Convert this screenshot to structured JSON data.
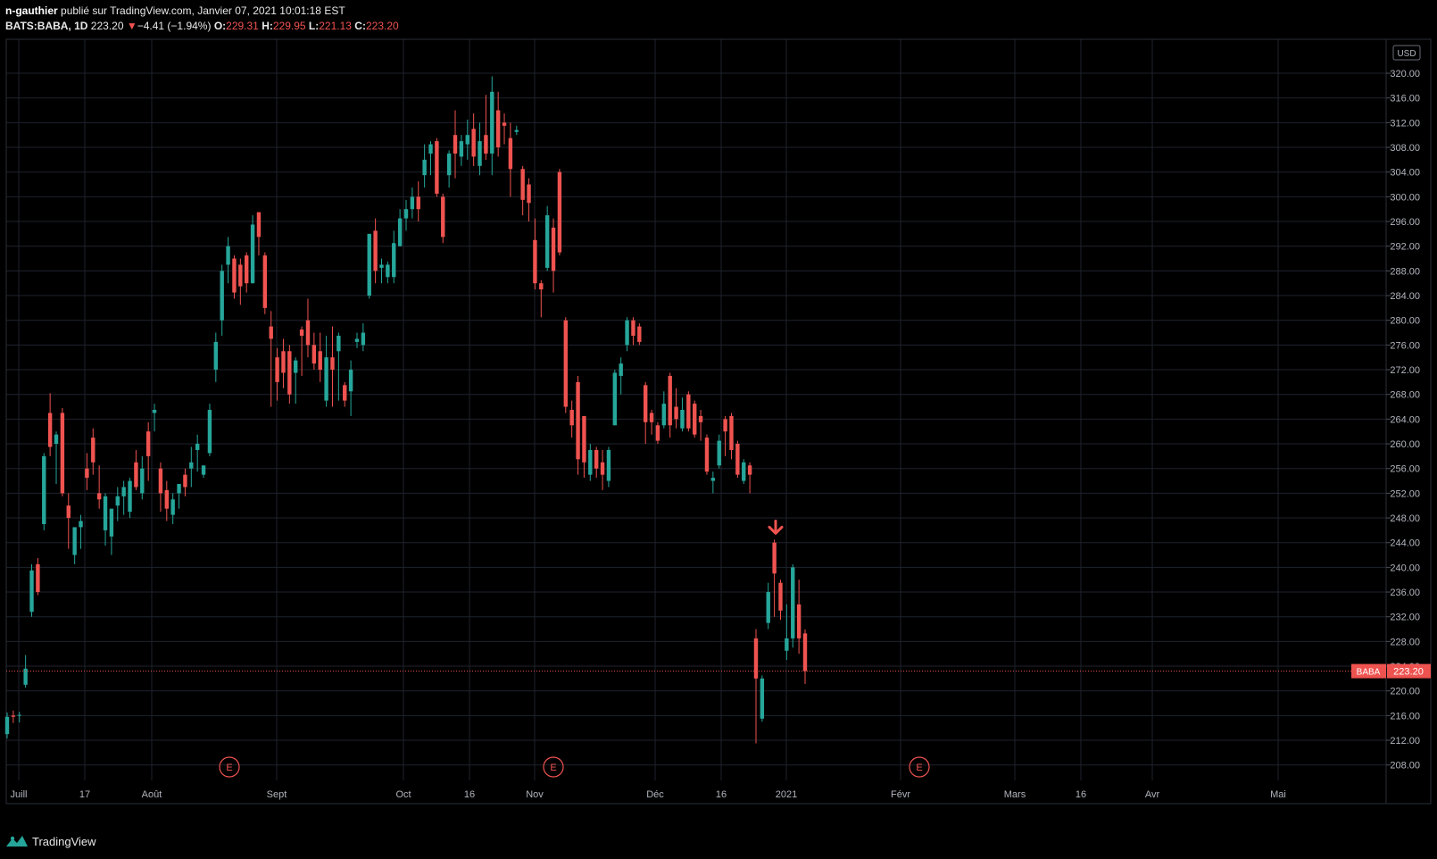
{
  "header": {
    "author": "n-gauthier",
    "published_text": "publié sur TradingView.com, Janvier 07, 2021 10:01:18 EST",
    "symbol": "BATS:BABA, 1D",
    "last_price": "223.20",
    "change": "−4.41 (−1.94%)",
    "open_label": "O:",
    "open": "229.31",
    "high_label": "H:",
    "high": "229.95",
    "low_label": "L:",
    "low": "221.13",
    "close_label": "C:",
    "close": "223.20"
  },
  "currency_badge": "USD",
  "price_tag": {
    "symbol": "BABA",
    "value": "223.20"
  },
  "footer": {
    "brand": "TradingView"
  },
  "colors": {
    "up": "#26a69a",
    "down": "#ef5350",
    "grid": "#1e222d",
    "background": "#000000"
  },
  "chart_data": {
    "type": "candlestick",
    "y_axis_ticks": [
      "320.00",
      "316.00",
      "312.00",
      "308.00",
      "304.00",
      "300.00",
      "296.00",
      "292.00",
      "288.00",
      "284.00",
      "280.00",
      "276.00",
      "272.00",
      "268.00",
      "264.00",
      "260.00",
      "256.00",
      "252.00",
      "248.00",
      "244.00",
      "240.00",
      "236.00",
      "232.00",
      "228.00",
      "224.00",
      "220.00",
      "216.00",
      "212.00",
      "208.00"
    ],
    "ylim": [
      205.5,
      325.5
    ],
    "x_axis_labels": [
      "Juill",
      "17",
      "Août",
      "Sept",
      "Oct",
      "16",
      "Nov",
      "Déc",
      "16",
      "2021",
      "Févr",
      "Mars",
      "16",
      "Avr",
      "Mai"
    ],
    "earnings_markers": [
      "E",
      "E",
      "E"
    ],
    "last_price_line": 223.2,
    "sell_signal_arrow": {
      "label": "down-arrow",
      "at_price": 245.5
    },
    "candles": [
      {
        "o": 213.0,
        "h": 216.5,
        "l": 212.3,
        "c": 215.8
      },
      {
        "o": 216.0,
        "h": 216.8,
        "l": 214.8,
        "c": 215.8
      },
      {
        "o": 216.0,
        "h": 216.6,
        "l": 214.9,
        "c": 216.1
      },
      {
        "o": 221.0,
        "h": 225.8,
        "l": 220.5,
        "c": 223.6
      },
      {
        "o": 232.8,
        "h": 240.5,
        "l": 232.0,
        "c": 239.5
      },
      {
        "o": 240.5,
        "h": 241.5,
        "l": 235.5,
        "c": 236.0
      },
      {
        "o": 247.0,
        "h": 258.5,
        "l": 246.0,
        "c": 258.0
      },
      {
        "o": 265.0,
        "h": 268.2,
        "l": 258.0,
        "c": 259.5
      },
      {
        "o": 260.0,
        "h": 262.0,
        "l": 253.5,
        "c": 261.5
      },
      {
        "o": 265.0,
        "h": 265.8,
        "l": 251.5,
        "c": 252.0
      },
      {
        "o": 250.0,
        "h": 252.0,
        "l": 243.0,
        "c": 248.0
      },
      {
        "o": 242.0,
        "h": 246.0,
        "l": 240.5,
        "c": 246.5
      },
      {
        "o": 246.5,
        "h": 248.5,
        "l": 243.0,
        "c": 247.5
      },
      {
        "o": 256.0,
        "h": 258.5,
        "l": 252.5,
        "c": 254.5
      },
      {
        "o": 261.0,
        "h": 262.5,
        "l": 255.0,
        "c": 257.0
      },
      {
        "o": 252.0,
        "h": 256.5,
        "l": 249.5,
        "c": 251.0
      },
      {
        "o": 246.0,
        "h": 252.0,
        "l": 243.5,
        "c": 251.5
      },
      {
        "o": 245.0,
        "h": 249.0,
        "l": 242.0,
        "c": 249.5
      },
      {
        "o": 250.0,
        "h": 253.0,
        "l": 247.5,
        "c": 251.5
      },
      {
        "o": 251.5,
        "h": 254.0,
        "l": 248.5,
        "c": 253.0
      },
      {
        "o": 249.0,
        "h": 254.5,
        "l": 248.0,
        "c": 254.0
      },
      {
        "o": 257.0,
        "h": 259.0,
        "l": 252.5,
        "c": 253.0
      },
      {
        "o": 252.0,
        "h": 258.0,
        "l": 251.0,
        "c": 256.0
      },
      {
        "o": 262.0,
        "h": 263.5,
        "l": 254.0,
        "c": 258.0
      },
      {
        "o": 265.0,
        "h": 266.5,
        "l": 262.0,
        "c": 265.5
      },
      {
        "o": 256.0,
        "h": 257.0,
        "l": 249.0,
        "c": 252.0
      },
      {
        "o": 252.5,
        "h": 254.0,
        "l": 247.5,
        "c": 249.5
      },
      {
        "o": 248.5,
        "h": 252.0,
        "l": 247.0,
        "c": 251.0
      },
      {
        "o": 252.0,
        "h": 253.5,
        "l": 249.5,
        "c": 253.5
      },
      {
        "o": 255.0,
        "h": 256.0,
        "l": 251.5,
        "c": 253.0
      },
      {
        "o": 256.0,
        "h": 259.5,
        "l": 253.0,
        "c": 257.0
      },
      {
        "o": 259.0,
        "h": 261.5,
        "l": 255.5,
        "c": 260.0
      },
      {
        "o": 255.0,
        "h": 256.5,
        "l": 254.5,
        "c": 256.5
      },
      {
        "o": 258.5,
        "h": 266.5,
        "l": 258.0,
        "c": 265.5
      },
      {
        "o": 272.0,
        "h": 278.0,
        "l": 270.0,
        "c": 276.5
      },
      {
        "o": 280.0,
        "h": 289.0,
        "l": 277.5,
        "c": 288.0
      },
      {
        "o": 289.0,
        "h": 293.5,
        "l": 286.0,
        "c": 292.0
      },
      {
        "o": 290.0,
        "h": 290.5,
        "l": 283.5,
        "c": 284.5
      },
      {
        "o": 289.0,
        "h": 290.0,
        "l": 282.5,
        "c": 285.5
      },
      {
        "o": 290.5,
        "h": 291.0,
        "l": 284.5,
        "c": 286.0
      },
      {
        "o": 286.0,
        "h": 297.0,
        "l": 286.0,
        "c": 295.5
      },
      {
        "o": 297.5,
        "h": 297.5,
        "l": 290.5,
        "c": 293.5
      },
      {
        "o": 290.5,
        "h": 291.0,
        "l": 281.0,
        "c": 282.0
      },
      {
        "o": 279.0,
        "h": 281.5,
        "l": 266.0,
        "c": 277.0
      },
      {
        "o": 274.0,
        "h": 275.5,
        "l": 267.0,
        "c": 270.0
      },
      {
        "o": 275.0,
        "h": 277.0,
        "l": 269.0,
        "c": 271.5
      },
      {
        "o": 275.0,
        "h": 276.0,
        "l": 266.5,
        "c": 268.0
      },
      {
        "o": 271.5,
        "h": 274.0,
        "l": 266.5,
        "c": 273.5
      },
      {
        "o": 278.5,
        "h": 279.0,
        "l": 271.0,
        "c": 277.5
      },
      {
        "o": 280.0,
        "h": 283.5,
        "l": 274.0,
        "c": 276.0
      },
      {
        "o": 276.0,
        "h": 278.0,
        "l": 272.0,
        "c": 273.0
      },
      {
        "o": 275.0,
        "h": 278.0,
        "l": 270.0,
        "c": 272.0
      },
      {
        "o": 267.0,
        "h": 277.5,
        "l": 266.0,
        "c": 274.0
      },
      {
        "o": 274.0,
        "h": 279.0,
        "l": 266.0,
        "c": 272.0
      },
      {
        "o": 275.0,
        "h": 278.0,
        "l": 267.0,
        "c": 277.5
      },
      {
        "o": 269.5,
        "h": 270.0,
        "l": 266.0,
        "c": 267.0
      },
      {
        "o": 268.5,
        "h": 273.5,
        "l": 264.5,
        "c": 272.0
      },
      {
        "o": 276.5,
        "h": 278.0,
        "l": 275.5,
        "c": 277.0
      },
      {
        "o": 276.0,
        "h": 279.5,
        "l": 275.0,
        "c": 278.0
      },
      {
        "o": 284.0,
        "h": 288.0,
        "l": 283.5,
        "c": 294.0
      },
      {
        "o": 294.5,
        "h": 296.5,
        "l": 286.0,
        "c": 288.0
      },
      {
        "o": 288.5,
        "h": 290.0,
        "l": 286.0,
        "c": 289.0
      },
      {
        "o": 287.0,
        "h": 289.5,
        "l": 286.0,
        "c": 289.0
      },
      {
        "o": 287.0,
        "h": 294.5,
        "l": 286.0,
        "c": 292.5
      },
      {
        "o": 292.0,
        "h": 298.0,
        "l": 292.0,
        "c": 296.5
      },
      {
        "o": 296.5,
        "h": 299.5,
        "l": 294.5,
        "c": 298.0
      },
      {
        "o": 298.0,
        "h": 301.5,
        "l": 296.5,
        "c": 300.0
      },
      {
        "o": 300.0,
        "h": 302.5,
        "l": 296.0,
        "c": 298.0
      },
      {
        "o": 303.5,
        "h": 308.5,
        "l": 301.5,
        "c": 306.0
      },
      {
        "o": 307.0,
        "h": 309.0,
        "l": 303.5,
        "c": 308.5
      },
      {
        "o": 309.0,
        "h": 309.5,
        "l": 300.0,
        "c": 300.5
      },
      {
        "o": 300.0,
        "h": 300.5,
        "l": 292.5,
        "c": 293.5
      },
      {
        "o": 303.5,
        "h": 307.5,
        "l": 301.5,
        "c": 307.0
      },
      {
        "o": 310.0,
        "h": 314.0,
        "l": 303.0,
        "c": 307.0
      },
      {
        "o": 306.5,
        "h": 310.0,
        "l": 305.0,
        "c": 309.0
      },
      {
        "o": 308.5,
        "h": 312.5,
        "l": 306.0,
        "c": 310.0
      },
      {
        "o": 311.0,
        "h": 313.5,
        "l": 305.0,
        "c": 306.5
      },
      {
        "o": 305.0,
        "h": 312.0,
        "l": 303.5,
        "c": 309.0
      },
      {
        "o": 310.0,
        "h": 316.5,
        "l": 306.0,
        "c": 307.0
      },
      {
        "o": 307.0,
        "h": 319.5,
        "l": 303.5,
        "c": 317.0
      },
      {
        "o": 314.0,
        "h": 317.0,
        "l": 306.5,
        "c": 308.0
      },
      {
        "o": 312.0,
        "h": 313.5,
        "l": 308.5,
        "c": 311.5
      },
      {
        "o": 309.5,
        "h": 312.0,
        "l": 300.0,
        "c": 304.5
      },
      {
        "o": 310.5,
        "h": 311.5,
        "l": 310.0,
        "c": 310.8
      },
      {
        "o": 304.5,
        "h": 305.0,
        "l": 297.0,
        "c": 299.5
      },
      {
        "o": 302.0,
        "h": 303.0,
        "l": 296.0,
        "c": 299.0
      },
      {
        "o": 293.0,
        "h": 296.5,
        "l": 285.0,
        "c": 286.0
      },
      {
        "o": 286.0,
        "h": 286.5,
        "l": 280.5,
        "c": 285.0
      },
      {
        "o": 288.5,
        "h": 298.5,
        "l": 288.0,
        "c": 297.0
      },
      {
        "o": 295.0,
        "h": 296.5,
        "l": 284.5,
        "c": 288.0
      },
      {
        "o": 304.0,
        "h": 304.5,
        "l": 290.5,
        "c": 291.0
      },
      {
        "o": 280.0,
        "h": 280.5,
        "l": 265.0,
        "c": 266.0
      },
      {
        "o": 265.5,
        "h": 267.0,
        "l": 261.0,
        "c": 263.0
      },
      {
        "o": 270.0,
        "h": 271.0,
        "l": 255.0,
        "c": 257.5
      },
      {
        "o": 264.5,
        "h": 264.5,
        "l": 254.5,
        "c": 257.0
      },
      {
        "o": 255.0,
        "h": 260.0,
        "l": 254.0,
        "c": 259.0
      },
      {
        "o": 259.0,
        "h": 259.5,
        "l": 254.5,
        "c": 256.0
      },
      {
        "o": 257.0,
        "h": 259.0,
        "l": 252.5,
        "c": 255.0
      },
      {
        "o": 254.0,
        "h": 259.5,
        "l": 253.0,
        "c": 259.0
      },
      {
        "o": 263.0,
        "h": 272.0,
        "l": 263.0,
        "c": 271.5
      },
      {
        "o": 271.0,
        "h": 274.0,
        "l": 268.0,
        "c": 273.0
      },
      {
        "o": 276.0,
        "h": 280.5,
        "l": 275.0,
        "c": 280.0
      },
      {
        "o": 280.0,
        "h": 280.5,
        "l": 276.0,
        "c": 277.5
      },
      {
        "o": 279.0,
        "h": 279.5,
        "l": 276.0,
        "c": 276.5
      },
      {
        "o": 269.5,
        "h": 270.0,
        "l": 260.0,
        "c": 263.5
      },
      {
        "o": 265.0,
        "h": 265.5,
        "l": 261.5,
        "c": 263.5
      },
      {
        "o": 263.0,
        "h": 263.5,
        "l": 260.0,
        "c": 260.5
      },
      {
        "o": 263.0,
        "h": 268.5,
        "l": 262.5,
        "c": 266.5
      },
      {
        "o": 271.0,
        "h": 271.5,
        "l": 261.0,
        "c": 263.0
      },
      {
        "o": 266.0,
        "h": 269.0,
        "l": 262.5,
        "c": 264.0
      },
      {
        "o": 262.5,
        "h": 267.5,
        "l": 262.0,
        "c": 265.5
      },
      {
        "o": 268.0,
        "h": 268.5,
        "l": 262.0,
        "c": 262.5
      },
      {
        "o": 266.5,
        "h": 267.0,
        "l": 261.0,
        "c": 261.5
      },
      {
        "o": 264.5,
        "h": 265.5,
        "l": 260.5,
        "c": 263.5
      },
      {
        "o": 261.0,
        "h": 261.5,
        "l": 255.0,
        "c": 255.5
      },
      {
        "o": 254.0,
        "h": 255.5,
        "l": 252.0,
        "c": 254.5
      },
      {
        "o": 256.5,
        "h": 261.5,
        "l": 256.0,
        "c": 260.5
      },
      {
        "o": 264.0,
        "h": 264.5,
        "l": 258.0,
        "c": 262.0
      },
      {
        "o": 264.5,
        "h": 265.0,
        "l": 257.5,
        "c": 259.0
      },
      {
        "o": 260.0,
        "h": 260.5,
        "l": 254.5,
        "c": 255.0
      },
      {
        "o": 254.0,
        "h": 257.5,
        "l": 253.5,
        "c": 257.0
      },
      {
        "o": 256.5,
        "h": 257.0,
        "l": 252.0,
        "c": 255.0
      },
      {
        "o": 228.5,
        "h": 230.0,
        "l": 211.5,
        "c": 222.0
      },
      {
        "o": 215.5,
        "h": 222.5,
        "l": 215.0,
        "c": 222.0
      },
      {
        "o": 231.0,
        "h": 237.5,
        "l": 230.0,
        "c": 236.0
      },
      {
        "o": 244.0,
        "h": 244.5,
        "l": 232.0,
        "c": 239.0
      },
      {
        "o": 237.5,
        "h": 238.0,
        "l": 231.5,
        "c": 233.0
      },
      {
        "o": 226.5,
        "h": 234.0,
        "l": 225.0,
        "c": 228.5
      },
      {
        "o": 228.5,
        "h": 240.5,
        "l": 227.0,
        "c": 240.0
      },
      {
        "o": 234.0,
        "h": 238.0,
        "l": 226.0,
        "c": 228.5
      },
      {
        "o": 229.3,
        "h": 229.95,
        "l": 221.13,
        "c": 223.2
      }
    ]
  }
}
